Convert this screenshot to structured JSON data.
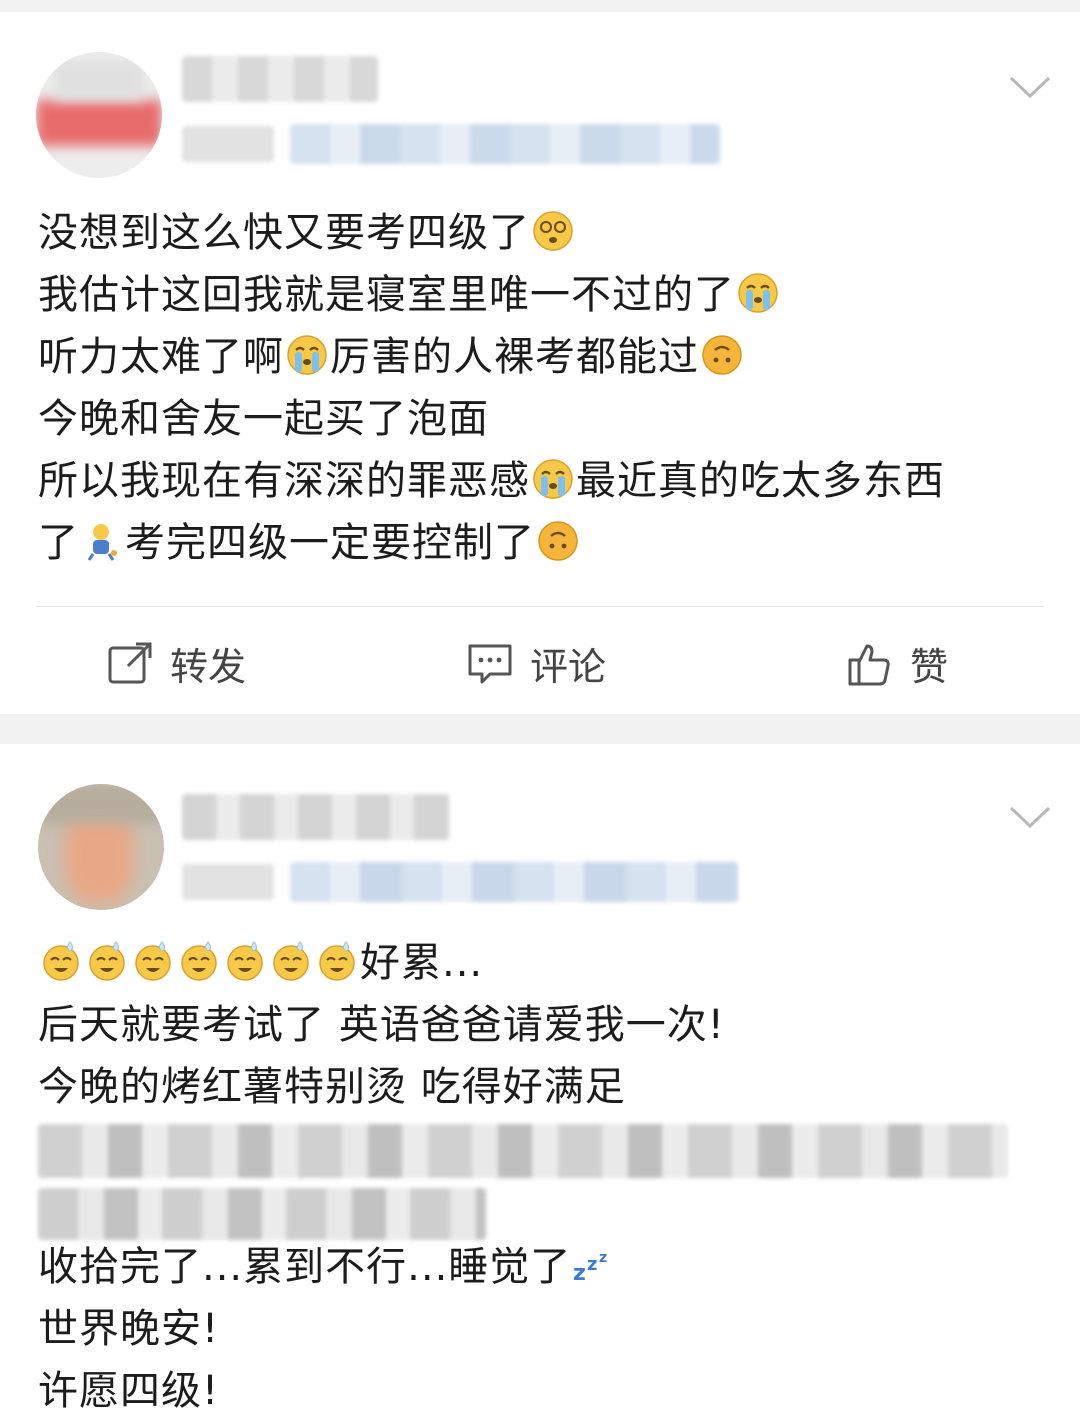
{
  "post1": {
    "lines": {
      "l1": "没想到这么快又要考四级了",
      "l2": "我估计这回我就是寝室里唯一不过的了",
      "l3a": "听力太难了啊",
      "l3b": "厉害的人裸考都能过",
      "l4": "今晚和舍友一起买了泡面",
      "l5a": "所以我现在有深深的罪恶感",
      "l5b": "最近真的吃太多东西",
      "l6a": "了",
      "l6b": "考完四级一定要控制了"
    },
    "emoji": [
      "dizzy-face",
      "crying-face",
      "crying-face",
      "upside-down-face",
      "crying-face",
      "cheering-figure",
      "upside-down-face"
    ],
    "actions": {
      "repost": "转发",
      "comment": "评论",
      "like": "赞"
    }
  },
  "post2": {
    "lines": {
      "l1": "好累...",
      "l2": "后天就要考试了 英语爸爸请爱我一次!",
      "l3": "今晚的烤红薯特别烫  吃得好满足",
      "l4": "收拾完了...累到不行...睡觉了",
      "l5": "世界晚安!",
      "l6": "许愿四级!"
    },
    "emoji": [
      "sweat-face",
      "sleep-zzz"
    ]
  },
  "colors": {
    "background": "#f2f2f2",
    "card": "#ffffff",
    "text": "#1c1c1c",
    "action_text": "#444444",
    "blur_blue": "#dbe6f2"
  }
}
